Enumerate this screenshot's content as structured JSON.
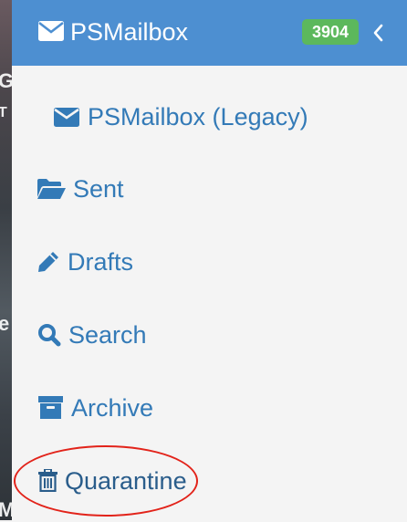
{
  "header": {
    "title": "PSMailbox",
    "badge_count": "3904",
    "colors": {
      "header_bg": "#4d8fd1",
      "badge_bg": "#5cb85c"
    }
  },
  "menu": {
    "items": [
      {
        "label": "PSMailbox (Legacy)",
        "icon": "envelope-icon"
      },
      {
        "label": "Sent",
        "icon": "folder-open-icon"
      },
      {
        "label": "Drafts",
        "icon": "pencil-icon"
      },
      {
        "label": "Search",
        "icon": "search-icon"
      },
      {
        "label": "Archive",
        "icon": "archive-icon"
      },
      {
        "label": "Quarantine",
        "icon": "trash-icon"
      }
    ]
  },
  "background_fragments": [
    "G",
    "T",
    "e",
    "M"
  ],
  "link_color": "#337ab7",
  "highlight_color": "#e2231a"
}
